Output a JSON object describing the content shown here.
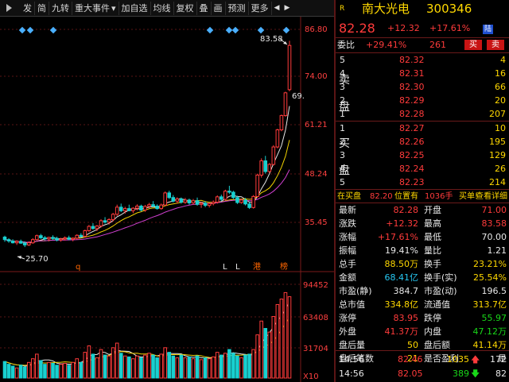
{
  "toolbar": {
    "items": [
      "发",
      "简",
      "九转",
      "重大事件",
      "加自选",
      "均线",
      "复权",
      "叠",
      "画",
      "预测",
      "更多"
    ]
  },
  "chart": {
    "price_ticks": [
      "86.80",
      "74.00",
      "61.21",
      "48.24",
      "35.45"
    ],
    "volume_ticks": [
      "94452",
      "63408",
      "31704",
      "X10"
    ],
    "max_label": "83.58",
    "min_label": "25.70",
    "last_tick_label": "69.",
    "markers": [
      "q",
      "L",
      "L",
      "港",
      "榜"
    ],
    "colors": {
      "up": "#ff3b3b",
      "down": "#19d0d0",
      "ma_white": "#e6e6e6",
      "ma_yellow": "#f0d000",
      "ma_purple": "#d040d0",
      "grid": "#5a1515"
    }
  },
  "chart_data": {
    "type": "candlestick",
    "ylim": [
      22.6,
      86.8
    ],
    "ohlc": [
      [
        28.5,
        28.9,
        27.2,
        27.8
      ],
      [
        27.8,
        28.2,
        26.9,
        27.4
      ],
      [
        27.4,
        27.9,
        26.7,
        26.9
      ],
      [
        26.9,
        27.6,
        26.3,
        27.3
      ],
      [
        27.3,
        27.8,
        26.6,
        26.8
      ],
      [
        26.8,
        27.3,
        25.7,
        26.3
      ],
      [
        26.3,
        27.3,
        26.0,
        26.9
      ],
      [
        26.9,
        28.2,
        26.6,
        27.8
      ],
      [
        27.8,
        29.2,
        27.5,
        28.9
      ],
      [
        28.9,
        29.4,
        28.0,
        28.3
      ],
      [
        28.3,
        28.8,
        27.6,
        28.0
      ],
      [
        28.0,
        28.6,
        27.3,
        28.4
      ],
      [
        28.4,
        29.0,
        27.7,
        28.1
      ],
      [
        28.1,
        28.6,
        27.3,
        27.7
      ],
      [
        27.7,
        28.3,
        27.2,
        28.0
      ],
      [
        28.0,
        28.7,
        27.5,
        28.3
      ],
      [
        28.3,
        28.9,
        27.6,
        27.9
      ],
      [
        27.9,
        28.4,
        27.3,
        28.2
      ],
      [
        28.2,
        29.3,
        27.8,
        29.0
      ],
      [
        29.0,
        29.6,
        28.3,
        28.7
      ],
      [
        28.7,
        30.6,
        28.4,
        30.3
      ],
      [
        30.3,
        31.9,
        30.0,
        31.5
      ],
      [
        31.5,
        32.4,
        30.6,
        30.9
      ],
      [
        30.9,
        31.9,
        30.2,
        31.6
      ],
      [
        31.6,
        33.5,
        31.2,
        33.1
      ],
      [
        33.1,
        34.1,
        32.3,
        32.7
      ],
      [
        32.7,
        33.8,
        32.0,
        33.4
      ],
      [
        33.4,
        35.3,
        32.9,
        34.9
      ],
      [
        34.9,
        37.6,
        34.4,
        36.9
      ],
      [
        36.9,
        37.9,
        35.5,
        35.9
      ],
      [
        35.9,
        37.0,
        35.1,
        36.5
      ],
      [
        36.5,
        37.6,
        35.8,
        35.9
      ],
      [
        35.9,
        36.9,
        35.2,
        36.6
      ],
      [
        36.6,
        37.7,
        36.0,
        37.2
      ],
      [
        37.2,
        37.6,
        35.7,
        36.1
      ],
      [
        36.1,
        37.5,
        35.6,
        37.1
      ],
      [
        37.1,
        38.1,
        36.6,
        37.6
      ],
      [
        37.6,
        38.6,
        36.9,
        37.2
      ],
      [
        37.2,
        37.7,
        36.2,
        36.5
      ],
      [
        36.5,
        37.9,
        36.2,
        37.5
      ],
      [
        37.5,
        41.3,
        37.2,
        40.9
      ],
      [
        40.9,
        41.5,
        39.2,
        39.6
      ],
      [
        39.6,
        40.3,
        38.2,
        38.6
      ],
      [
        38.6,
        39.7,
        37.9,
        39.2
      ],
      [
        39.2,
        39.6,
        37.9,
        38.3
      ],
      [
        38.3,
        39.5,
        37.8,
        38.9
      ],
      [
        38.9,
        39.3,
        37.6,
        38.1
      ],
      [
        38.1,
        39.2,
        37.6,
        38.7
      ],
      [
        38.7,
        39.6,
        37.3,
        37.7
      ],
      [
        37.7,
        38.4,
        36.7,
        38.0
      ],
      [
        38.0,
        38.6,
        36.9,
        37.4
      ],
      [
        37.4,
        38.2,
        36.8,
        37.9
      ],
      [
        37.9,
        38.8,
        37.4,
        38.3
      ],
      [
        38.3,
        40.2,
        37.9,
        39.8
      ],
      [
        39.8,
        40.4,
        38.6,
        39.1
      ],
      [
        39.1,
        41.8,
        38.8,
        41.4
      ],
      [
        41.4,
        42.9,
        40.6,
        41.1
      ],
      [
        41.1,
        41.5,
        39.2,
        39.6
      ],
      [
        39.6,
        40.1,
        37.8,
        38.2
      ],
      [
        38.2,
        39.3,
        37.9,
        38.9
      ],
      [
        38.9,
        39.5,
        37.4,
        37.8
      ],
      [
        37.8,
        38.3,
        36.4,
        36.8
      ],
      [
        36.8,
        40.3,
        36.5,
        39.9
      ],
      [
        39.9,
        46.3,
        39.6,
        45.9
      ],
      [
        45.9,
        50.6,
        45.2,
        49.9
      ],
      [
        49.9,
        51.3,
        46.3,
        46.9
      ],
      [
        46.9,
        49.3,
        46.5,
        48.9
      ],
      [
        48.9,
        54.3,
        48.6,
        53.8
      ],
      [
        53.8,
        58.9,
        53.4,
        58.6
      ],
      [
        58.6,
        62.9,
        58.2,
        62.6
      ],
      [
        62.6,
        69.3,
        62.3,
        69.0
      ],
      [
        69.9,
        83.6,
        69.4,
        82.3
      ]
    ],
    "volume": [
      18000,
      15000,
      13000,
      11000,
      14000,
      12000,
      17000,
      21000,
      26000,
      19000,
      15000,
      17000,
      16000,
      14000,
      15000,
      16000,
      14000,
      17000,
      21000,
      17000,
      28000,
      35000,
      26000,
      22000,
      31000,
      25000,
      24000,
      33000,
      38000,
      27000,
      24000,
      23000,
      21000,
      24000,
      22000,
      25000,
      27000,
      25000,
      22000,
      26000,
      33000,
      28000,
      24000,
      22000,
      25000,
      22000,
      23000,
      21000,
      24000,
      20000,
      22000,
      21000,
      23000,
      28000,
      25000,
      27000,
      31000,
      27000,
      24000,
      22000,
      25000,
      26000,
      31000,
      47000,
      62000,
      54000,
      50000,
      67000,
      80000,
      86000,
      93000,
      88500
    ]
  },
  "quote": {
    "symbol_letter": "R",
    "name": "南大光电",
    "code": "300346",
    "price": "82.28",
    "change": "+12.32",
    "change_pct": "+17.61%",
    "market_tag": "陆",
    "webi_label": "委比",
    "webi": "+29.41%",
    "weicha": "261",
    "buy_btn": "买",
    "sell_btn": "卖"
  },
  "asks": [
    {
      "lvl": "5",
      "price": "82.32",
      "vol": "4"
    },
    {
      "lvl": "4",
      "price": "82.31",
      "vol": "16"
    },
    {
      "lvl": "3",
      "price": "82.30",
      "vol": "66"
    },
    {
      "lvl": "2",
      "price": "82.29",
      "vol": "20"
    },
    {
      "lvl": "1",
      "price": "82.28",
      "vol": "207"
    }
  ],
  "bids": [
    {
      "lvl": "1",
      "price": "82.27",
      "vol": "10"
    },
    {
      "lvl": "2",
      "price": "82.26",
      "vol": "195"
    },
    {
      "lvl": "3",
      "price": "82.25",
      "vol": "129"
    },
    {
      "lvl": "4",
      "price": "82.24",
      "vol": "26"
    },
    {
      "lvl": "5",
      "price": "82.23",
      "vol": "214"
    }
  ],
  "ask_side_chars": [
    "卖",
    "盘"
  ],
  "bid_side_chars": [
    "买",
    "盘"
  ],
  "notice": {
    "pre": "在买盘",
    "price": "82.20",
    "mid": "位置有",
    "vol": "1036手",
    "post": "买单!",
    "link": "查看详细"
  },
  "stats": [
    {
      "l1": "最新",
      "v1": "82.28",
      "c1": "red",
      "l2": "开盘",
      "v2": "71.00",
      "c2": "red"
    },
    {
      "l1": "涨跌",
      "v1": "+12.32",
      "c1": "red",
      "l2": "最高",
      "v2": "83.58",
      "c2": "red"
    },
    {
      "l1": "涨幅",
      "v1": "+17.61%",
      "c1": "red",
      "l2": "最低",
      "v2": "70.00",
      "c2": "white"
    },
    {
      "l1": "振幅",
      "v1": "19.41%",
      "c1": "white",
      "l2": "量比",
      "v2": "1.21",
      "c2": "white"
    },
    {
      "l1": "总手",
      "v1": "88.50万",
      "c1": "yellow",
      "l2": "换手",
      "v2": "23.21%",
      "c2": "yellow"
    },
    {
      "l1": "金额",
      "v1": "68.41亿",
      "c1": "cyan",
      "l2": "换手(实)",
      "v2": "25.54%",
      "c2": "yellow"
    },
    {
      "l1": "市盈(静)",
      "v1": "384.7",
      "c1": "white",
      "l2": "市盈(动)",
      "v2": "196.5",
      "c2": "white"
    },
    {
      "l1": "总市值",
      "v1": "334.8亿",
      "c1": "yellow",
      "l2": "流通值",
      "v2": "313.7亿",
      "c2": "yellow"
    },
    {
      "l1": "涨停",
      "v1": "83.95",
      "c1": "red",
      "l2": "跌停",
      "v2": "55.97",
      "c2": "green"
    },
    {
      "l1": "外盘",
      "v1": "41.37万",
      "c1": "red",
      "l2": "内盘",
      "v2": "47.12万",
      "c2": "green"
    },
    {
      "l1": "盘后量",
      "v1": "50",
      "c1": "yellow",
      "l2": "盘后额",
      "v2": "41.14万",
      "c2": "yellow"
    },
    {
      "l1": "盘后笔数",
      "v1": "21",
      "c1": "yellow",
      "l2": "是否盈利",
      "v2": "是",
      "c2": "white"
    }
  ],
  "ticks": [
    {
      "time": "14:56",
      "price": "82.46",
      "vol": "1035",
      "dir": "up",
      "num": "172"
    },
    {
      "time": "14:56",
      "price": "82.05",
      "vol": "389",
      "dir": "down",
      "num": "82"
    }
  ]
}
